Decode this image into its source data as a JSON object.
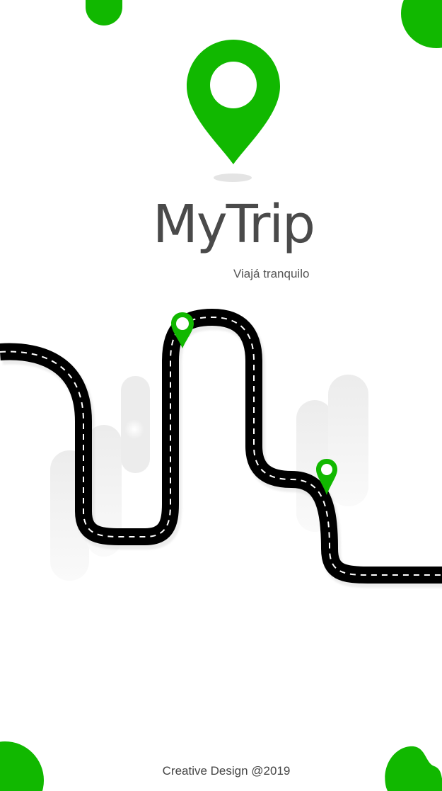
{
  "app": {
    "title": "MyTrip",
    "tagline": "Viajá tranquilo",
    "footer": "Creative Design @2019"
  },
  "icons": {
    "logo": "location-pin-icon",
    "waypoints": [
      "location-pin-icon",
      "location-pin-icon"
    ]
  },
  "colors": {
    "brand_green": "#11b800",
    "text_dark": "#4a4a4a",
    "road": "#000000",
    "road_marking": "#ffffff",
    "background": "#ffffff"
  }
}
